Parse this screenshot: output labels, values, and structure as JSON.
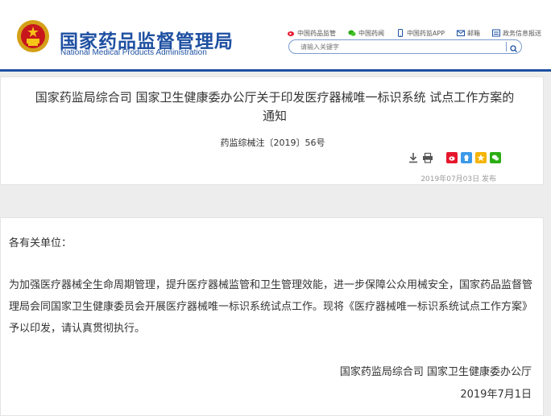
{
  "header": {
    "brand_cn": "国家药品监督管理局",
    "brand_en": "National Medical Products Administration",
    "links": [
      {
        "label": "中国药品监管",
        "icon": "weibo-icon"
      },
      {
        "label": "中国药闻",
        "icon": "wechat-icon"
      },
      {
        "label": "中国药监APP",
        "icon": "phone-icon"
      },
      {
        "label": "邮箱",
        "icon": "mail-icon"
      },
      {
        "label": "政务信息报送",
        "icon": "report-icon"
      }
    ],
    "search_placeholder": "请输入关键字"
  },
  "article": {
    "title": "国家药监局综合司 国家卫生健康委办公厅关于印发医疗器械唯一标识系统 试点工作方案的通知",
    "doc_no": "药监综械注〔2019〕56号",
    "published": "2019年07月03日 发布"
  },
  "content": {
    "salutation": "各有关单位：",
    "paragraph": "为加强医疗器械全生命周期管理，提升医疗器械监管和卫生管理效能，进一步保障公众用械安全，国家药品监督管理局会同国家卫生健康委员会开展医疗器械唯一标识系统试点工作。现将《医疗器械唯一标识系统试点工作方案》予以印发，请认真贯彻执行。",
    "signature_org": "国家药监局综合司 国家卫生健康委办公厅",
    "signature_date": "2019年7月1日"
  },
  "colors": {
    "brand_blue": "#1e50a2",
    "weibo_red": "#e6162d",
    "qzone_blue": "#3d9ae8",
    "star_yellow": "#f5b400",
    "wechat_green": "#2bad13"
  }
}
